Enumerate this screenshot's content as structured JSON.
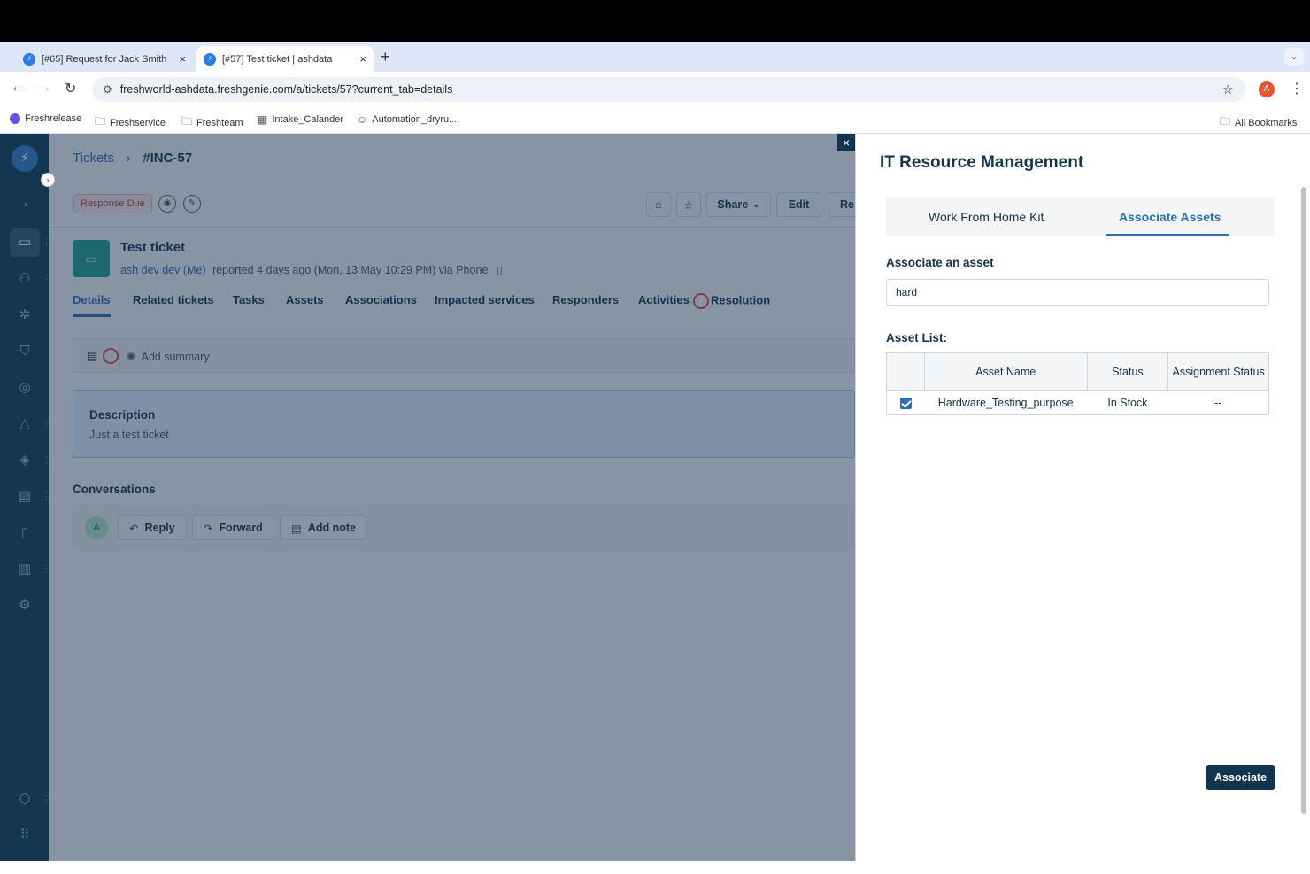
{
  "browser": {
    "tabs": [
      {
        "title": "[#65] Request for Jack Smith",
        "close": "×"
      },
      {
        "title": "[#57] Test ticket | ashdata",
        "close": "×"
      }
    ],
    "new_tab": "+",
    "tab_menu": "⌄",
    "url": "freshworld-ashdata.freshgenie.com/a/tickets/57?current_tab=details",
    "profile_initial": "A",
    "bookmarks": [
      "Freshrelease",
      "Freshservice",
      "Freshteam",
      "Intake_Calander",
      "Automation_dryru..."
    ],
    "all_bookmarks": "All Bookmarks"
  },
  "breadcrumb": {
    "parent": "Tickets",
    "current": "#INC-57"
  },
  "toolbar": {
    "response_due": "Response Due",
    "share": "Share",
    "edit": "Edit",
    "reply": "Rep"
  },
  "ticket": {
    "title": "Test ticket",
    "requester": "ash dev dev (Me)",
    "meta": "reported 4 days ago (Mon, 13 May 10:29 PM) via Phone"
  },
  "detail_tabs": [
    "Details",
    "Related tickets",
    "Tasks",
    "Assets",
    "Associations",
    "Impacted services",
    "Responders",
    "Activities",
    "Resolution"
  ],
  "summary": {
    "add_label": "Add summary"
  },
  "description": {
    "heading": "Description",
    "body": "Just a test ticket"
  },
  "conversations": {
    "heading": "Conversations",
    "avatar": "A",
    "reply": "Reply",
    "forward": "Forward",
    "add_note": "Add note"
  },
  "panel": {
    "title": "IT Resource Management",
    "tabs": [
      "Work From Home Kit",
      "Associate Assets"
    ],
    "active_tab": "Associate Assets",
    "associate_label": "Associate an asset",
    "search_value": "hard",
    "asset_list_label": "Asset List:",
    "columns": [
      "Asset Name",
      "Status",
      "Assignment Status"
    ],
    "rows": [
      {
        "checked": true,
        "name": "Hardware_Testing_purpose",
        "status": "In Stock",
        "assignment": "--"
      }
    ],
    "associate_button": "Associate",
    "close": "×"
  },
  "colors": {
    "sidebar": "#123a55",
    "accent": "#2c6fb5",
    "primary_button": "#12344d"
  }
}
